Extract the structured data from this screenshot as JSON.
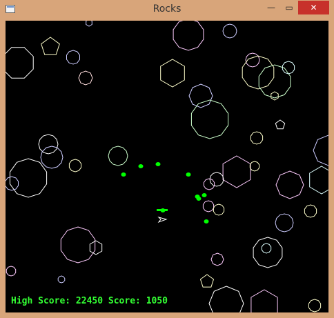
{
  "window": {
    "title": "Rocks",
    "minimize_glyph": "—",
    "maximize_glyph": "▭",
    "close_glyph": "✕"
  },
  "hud": {
    "high_score_label": "High Score:",
    "high_score": "22450",
    "score_label": "Score:",
    "score": "1050"
  },
  "colors": {
    "background": "#000000",
    "hud_text": "#33ff33",
    "bullet": "#00ff00",
    "ship": "#ffffff",
    "rock_palette": [
      "#ffffff",
      "#ffccff",
      "#ccffcc",
      "#ccccff",
      "#ffffcc",
      "#ffdddd",
      "#ddffff"
    ]
  },
  "icons": {
    "app": "window-icon",
    "ship": "ship-icon"
  }
}
